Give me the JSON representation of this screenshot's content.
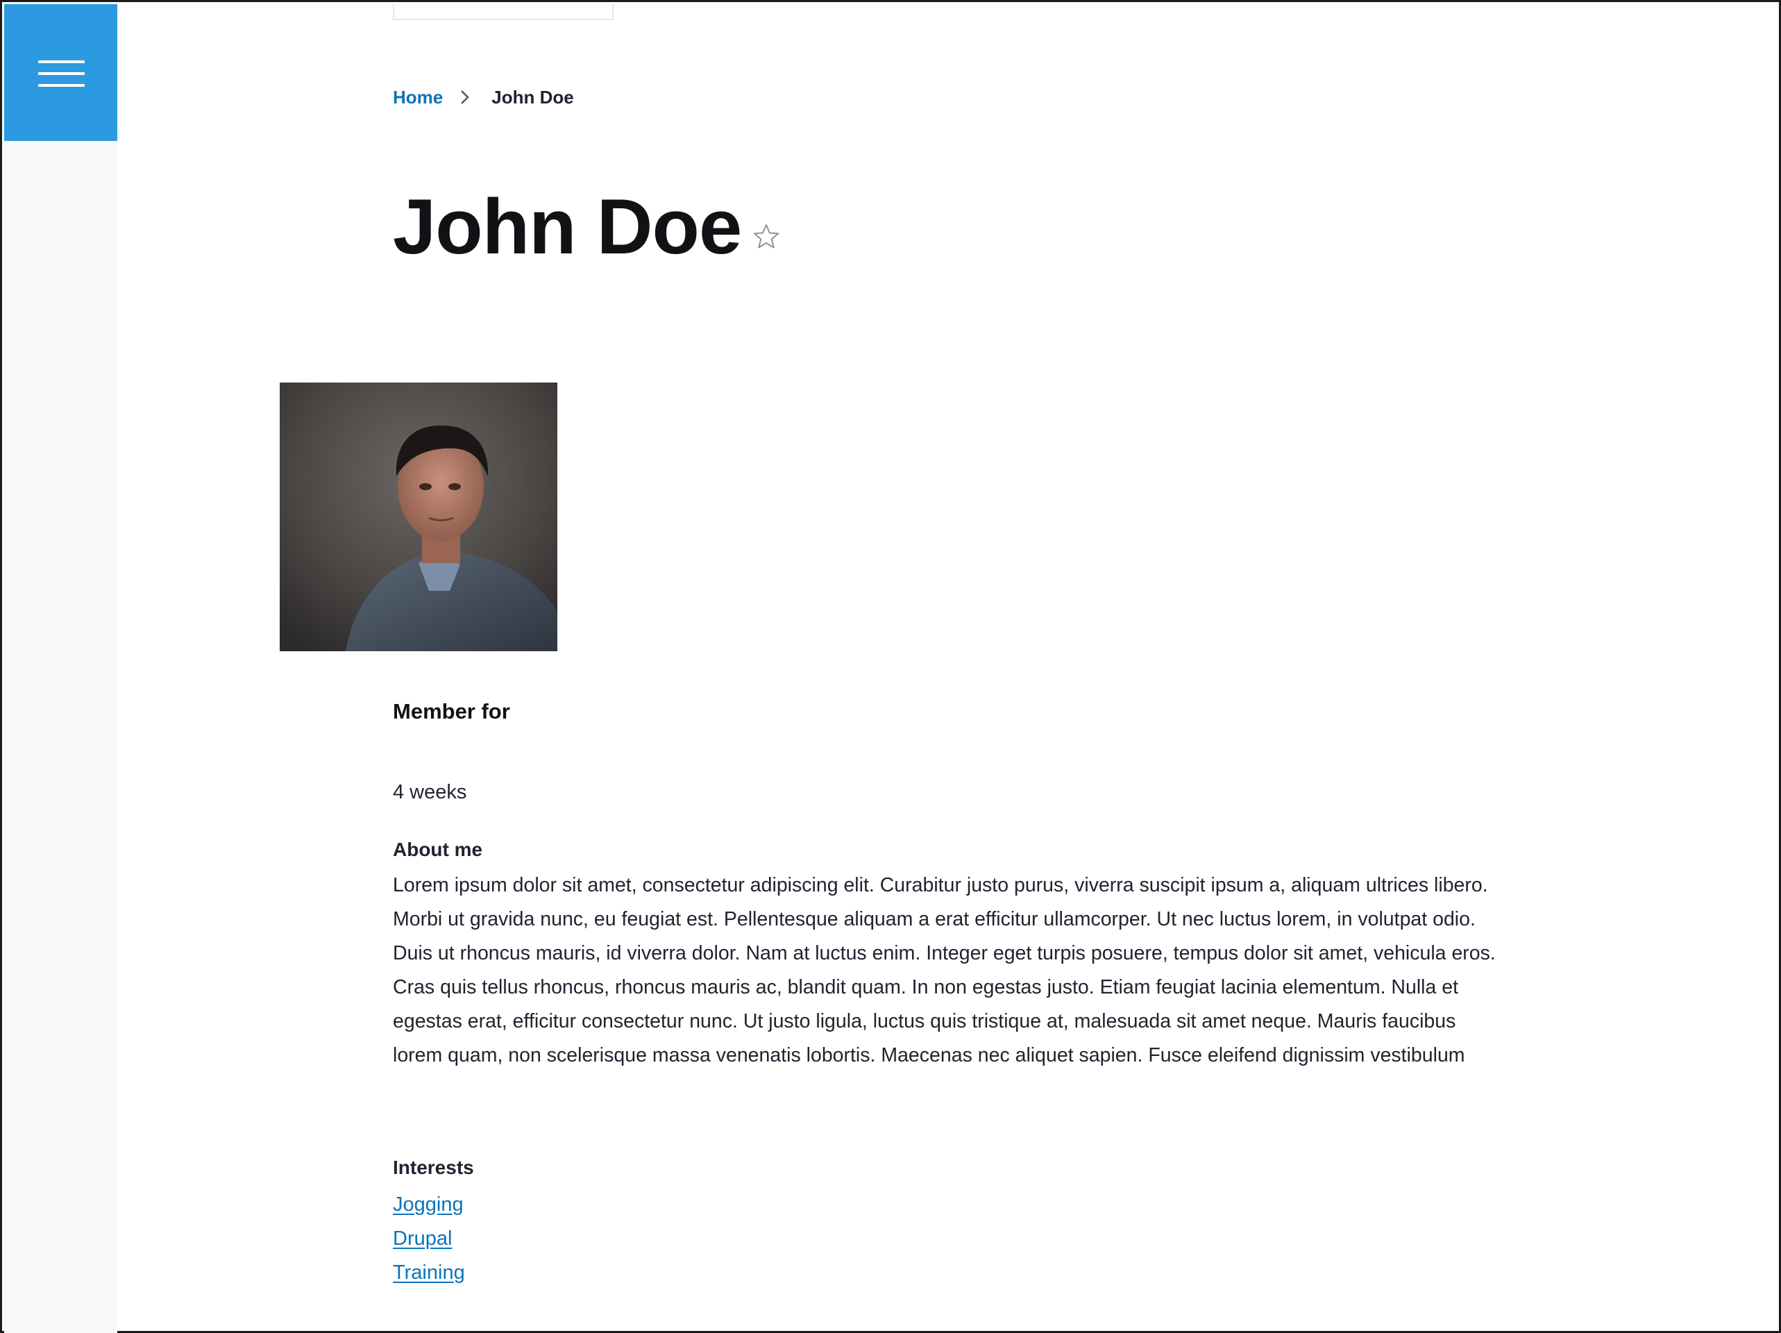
{
  "breadcrumb": {
    "home": "Home",
    "current": "John Doe"
  },
  "page": {
    "title": "John Doe"
  },
  "member": {
    "label": "Member for",
    "value": "4 weeks"
  },
  "about": {
    "label": "About me",
    "text": "Lorem ipsum dolor sit amet, consectetur adipiscing elit. Curabitur justo purus, viverra suscipit ipsum a, aliquam ultrices libero. Morbi ut gravida nunc, eu feugiat est. Pellentesque aliquam a erat efficitur ullamcorper. Ut nec luctus lorem, in volutpat odio. Duis ut rhoncus mauris, id viverra dolor. Nam at luctus enim. Integer eget turpis posuere, tempus dolor sit amet, vehicula eros. Cras quis tellus rhoncus, rhoncus mauris ac, blandit quam. In non egestas justo. Etiam feugiat lacinia elementum. Nulla et egestas erat, efficitur consectetur nunc. Ut justo ligula, luctus quis tristique at, malesuada sit amet neque. Mauris faucibus lorem quam, non scelerisque massa venenatis lobortis. Maecenas nec aliquet sapien. Fusce eleifend dignissim vestibulum"
  },
  "interests": {
    "label": "Interests",
    "items": [
      "Jogging",
      "Drupal",
      "Training"
    ]
  },
  "icons": {
    "menu": "hamburger-menu-icon",
    "separator": "chevron-right-icon",
    "favorite": "star-outline-icon"
  },
  "colors": {
    "menu_bg": "#2b9ae0",
    "link": "#0b73b9",
    "title": "#101215",
    "sidebar_bg": "#f7f8fa"
  }
}
